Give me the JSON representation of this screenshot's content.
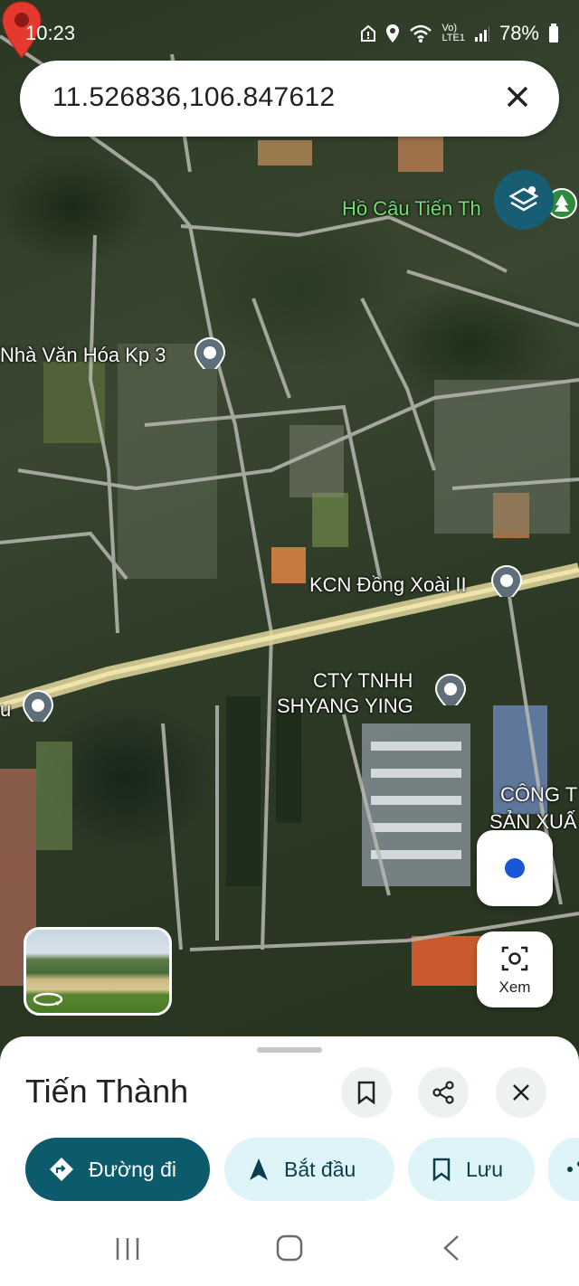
{
  "status_bar": {
    "time": "10:23",
    "lte_top": "Vo)",
    "lte_bottom": "LTE1",
    "battery": "78%"
  },
  "search": {
    "query": "11.526836,106.847612"
  },
  "map_labels": {
    "ho_cau": "Hồ Câu Tiến Th",
    "nha_van_hoa": "Nhà Văn Hóa Kp 3",
    "kcn": "KCN Đồng Xoài II",
    "cty_line1": "CTY TNHH",
    "cty_line2": "SHYANG YING",
    "cong_ty_line1": "CÔNG T",
    "cong_ty_line2": "SẢN XUẤ",
    "left_fragment": "u"
  },
  "xem_button": {
    "label": "Xem"
  },
  "place": {
    "title": "Tiến Thành"
  },
  "actions": {
    "directions": "Đường đi",
    "start": "Bắt đầu",
    "save": "Lưu"
  }
}
